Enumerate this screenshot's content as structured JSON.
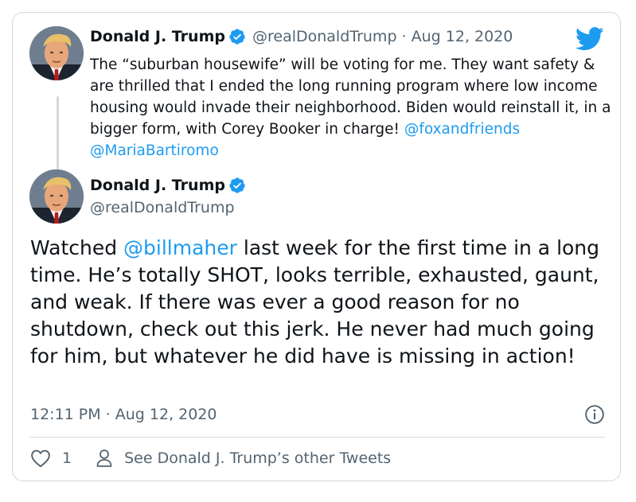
{
  "colors": {
    "accent": "#1d9bf0",
    "text": "#0f1419",
    "muted": "#536471",
    "border": "#cfd9de"
  },
  "quoted_tweet": {
    "display_name": "Donald J. Trump",
    "handle": "@realDonaldTrump",
    "separator": " · ",
    "date": "Aug 12, 2020",
    "text_parts": [
      "The “suburban housewife” will be voting for me. They want safety & are thrilled that I ended the long running program where low income housing would invade their neighborhood. Biden would reinstall it, in a bigger form, with Corey Booker in charge! ",
      "@foxandfriends",
      " ",
      "@MariaBartiromo"
    ]
  },
  "main_tweet": {
    "display_name": "Donald J. Trump",
    "handle": "@realDonaldTrump",
    "text_parts": [
      "Watched ",
      "@billmaher",
      " last week for the first time in a long time. He’s totally SHOT, looks terrible, exhausted, gaunt, and weak. If there was ever a good reason for no shutdown, check out this jerk. He never had much going for him, but whatever he did have is missing in action!"
    ],
    "timestamp": "12:11 PM · Aug 12, 2020"
  },
  "footer": {
    "like_count": "1",
    "see_more": "See Donald J. Trump’s other Tweets"
  },
  "icons": {
    "brand": "twitter-bird-icon",
    "verified": "verified-badge-icon",
    "info": "info-icon",
    "like": "heart-icon",
    "profile": "person-icon"
  }
}
